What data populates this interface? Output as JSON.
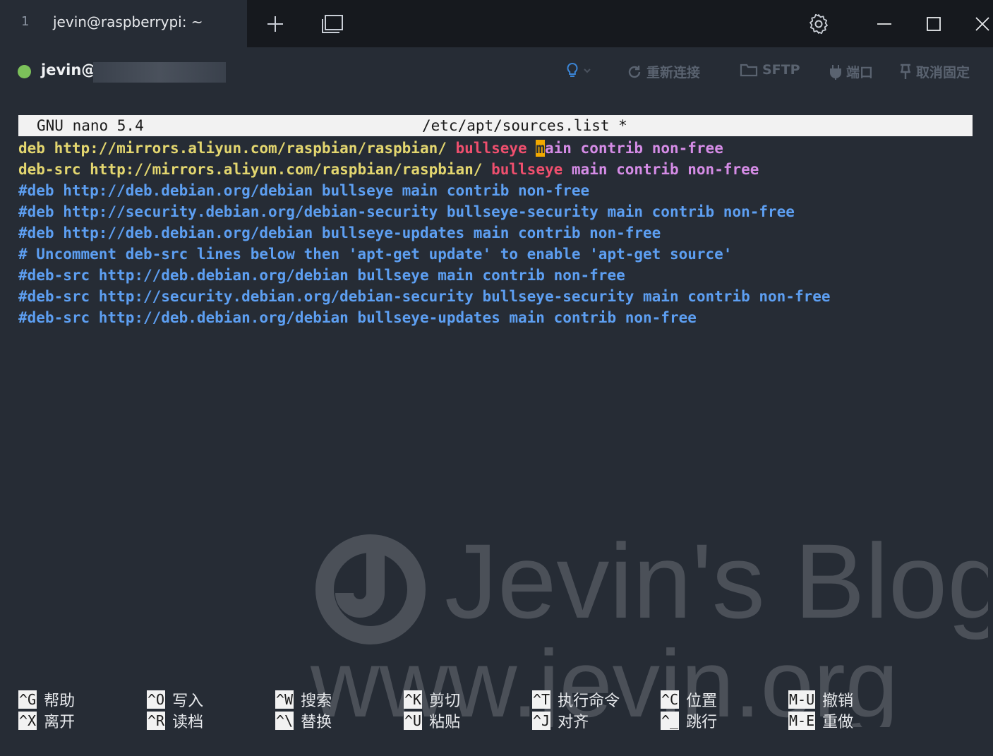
{
  "titlebar": {
    "tab_index": "1",
    "tab_title": "jevin@raspberrypi: ~"
  },
  "status": {
    "host": "jevin@",
    "actions": {
      "reconnect": "重新连接",
      "sftp": "SFTP",
      "port": "端口",
      "unpin": "取消固定"
    }
  },
  "nano": {
    "version": "GNU nano 5.4",
    "filename": "/etc/apt/sources.list *",
    "lines": [
      {
        "a": "deb ",
        "b": "http://mirrors.aliyun.com/raspbian/raspbian/ ",
        "c": "bullseye ",
        "cur": "m",
        "d": "ain contrib non-free"
      },
      {
        "a": "deb-src ",
        "b": "http://mirrors.aliyun.com/raspbian/raspbian/ ",
        "c": "bullseye ",
        "d": "main contrib non-free"
      },
      {
        "t": "#deb http://deb.debian.org/debian bullseye main contrib non-free"
      },
      {
        "t": "#deb http://security.debian.org/debian-security bullseye-security main contrib non-free"
      },
      {
        "t": "#deb http://deb.debian.org/debian bullseye-updates main contrib non-free"
      },
      {
        "t": "# Uncomment deb-src lines below then 'apt-get update' to enable 'apt-get source'"
      },
      {
        "t": "#deb-src http://deb.debian.org/debian bullseye main contrib non-free"
      },
      {
        "t": "#deb-src http://security.debian.org/debian-security bullseye-security main contrib non-free"
      },
      {
        "t": "#deb-src http://deb.debian.org/debian bullseye-updates main contrib non-free"
      }
    ],
    "shortcuts": [
      {
        "k1": "^G",
        "l1": "帮助",
        "k2": "^X",
        "l2": "离开"
      },
      {
        "k1": "^O",
        "l1": "写入",
        "k2": "^R",
        "l2": "读档"
      },
      {
        "k1": "^W",
        "l1": "搜索",
        "k2": "^\\",
        "l2": "替换"
      },
      {
        "k1": "^K",
        "l1": "剪切",
        "k2": "^U",
        "l2": "粘贴"
      },
      {
        "k1": "^T",
        "l1": "执行命令",
        "k2": "^J",
        "l2": "对齐"
      },
      {
        "k1": "^C",
        "l1": "位置",
        "k2": "^_",
        "l2": "跳行"
      },
      {
        "k1": "M-U",
        "l1": "撤销",
        "k2": "M-E",
        "l2": "重做"
      }
    ]
  },
  "watermark": {
    "line1": "Jevin's Blog",
    "line2": "www.jevin.org"
  },
  "colors": {
    "background": "#262c35",
    "titlebar": "#16191e",
    "green_dot": "#7cc15a",
    "deb_keyword": "#e3d66f",
    "suite": "#ef4f6e",
    "component": "#d58ce6",
    "comment": "#5d9ff2",
    "cursor": "#f2a900"
  }
}
